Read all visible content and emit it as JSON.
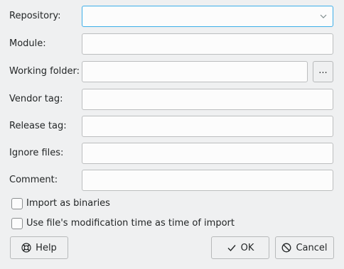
{
  "form": {
    "repository": {
      "label": "Repository:",
      "value": ""
    },
    "module": {
      "label": "Module:",
      "value": ""
    },
    "working_folder": {
      "label": "Working folder:",
      "value": "",
      "browse_label": "..."
    },
    "vendor_tag": {
      "label": "Vendor tag:",
      "value": ""
    },
    "release_tag": {
      "label": "Release tag:",
      "value": ""
    },
    "ignore_files": {
      "label": "Ignore files:",
      "value": ""
    },
    "comment": {
      "label": "Comment:",
      "value": ""
    }
  },
  "options": {
    "import_binaries": {
      "label": "Import as binaries",
      "checked": false
    },
    "use_mod_time": {
      "label": "Use file's modification time as time of import",
      "checked": false
    }
  },
  "buttons": {
    "help": "Help",
    "ok": "OK",
    "cancel": "Cancel"
  },
  "icons": {
    "help": "lifebuoy-icon",
    "ok": "checkmark-icon",
    "cancel": "cancel-icon",
    "combo": "chevron-down-icon"
  },
  "colors": {
    "focus_border": "#3daee9",
    "background": "#eff0f1"
  }
}
